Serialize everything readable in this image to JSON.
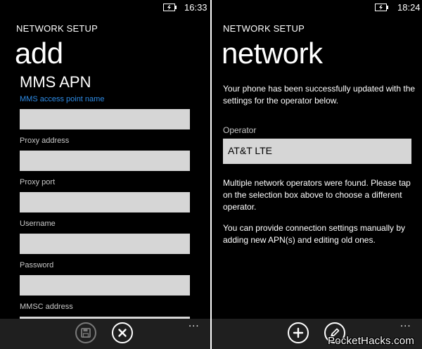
{
  "left_screen": {
    "status": {
      "battery_icon": "battery-charging-icon",
      "time": "16:33"
    },
    "app_title": "NETWORK SETUP",
    "page_title": "add",
    "section_title": "MMS APN",
    "section_subtitle": "MMS access point name",
    "fields": [
      {
        "label": "Proxy address",
        "value": ""
      },
      {
        "label": "Proxy port",
        "value": ""
      },
      {
        "label": "Username",
        "value": ""
      },
      {
        "label": "Password",
        "value": ""
      },
      {
        "label": "MMSC address",
        "value": ""
      }
    ],
    "mms_apn_value": "",
    "app_bar": {
      "buttons": [
        "save-icon",
        "cancel-icon"
      ],
      "more": "..."
    }
  },
  "right_screen": {
    "status": {
      "battery_icon": "battery-charging-icon",
      "time": "18:24"
    },
    "app_title": "NETWORK SETUP",
    "page_title": "network",
    "intro": "Your phone has been successfully updated with the settings for the operator below.",
    "operator_label": "Operator",
    "operator_value": "AT&T LTE",
    "multiple_notice": "Multiple network operators were found. Please tap on the selection box above to choose a different operator.",
    "manual_notice": "You can provide connection settings manually by adding new APN(s) and editing old ones.",
    "app_bar": {
      "buttons": [
        "add-icon",
        "edit-icon"
      ],
      "more": "..."
    }
  },
  "watermark": "PocketHacks.com",
  "colors": {
    "background": "#000000",
    "accent": "#2e8ce6",
    "input": "#d6d6d6",
    "app_bar": "#1f1f1f"
  }
}
